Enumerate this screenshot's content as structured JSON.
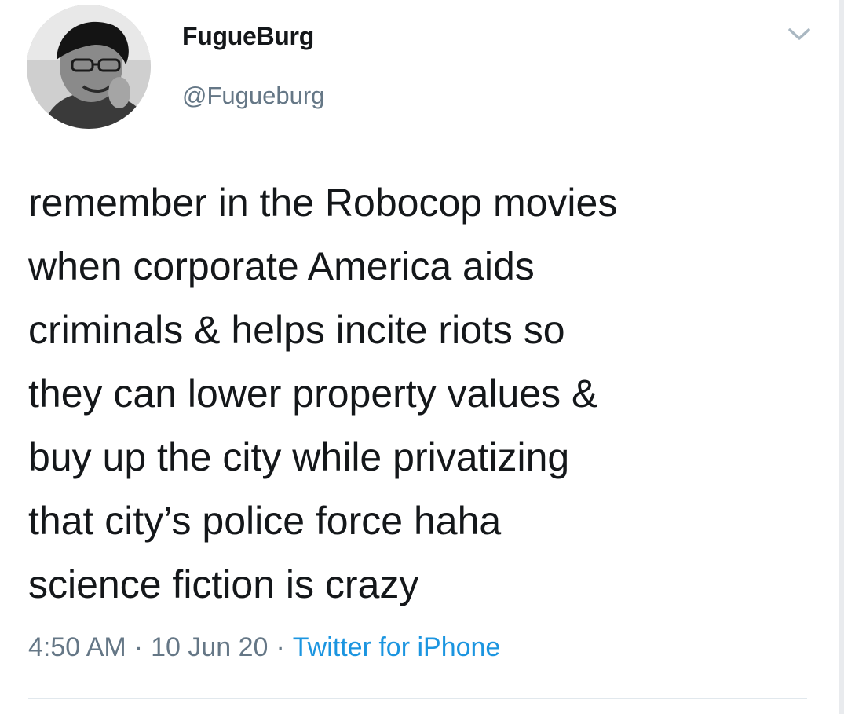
{
  "tweet": {
    "display_name": "FugueBurg",
    "handle": "@Fugueburg",
    "text": "remember in the Robocop movies\nwhen corporate America aids\ncriminals & helps incite riots so\nthey can lower property values &\nbuy up the city while privatizing\nthat city’s police force haha\nscience fiction is crazy",
    "time": "4:50 AM",
    "separator": "·",
    "date": "10 Jun 20",
    "source": "Twitter for iPhone"
  },
  "icons": {
    "avatar": "profile-photo",
    "menu": "chevron-down-icon"
  },
  "colors": {
    "text": "#14171a",
    "secondary": "#657786",
    "link": "#1b95e0",
    "divider": "#e1e8ed"
  }
}
